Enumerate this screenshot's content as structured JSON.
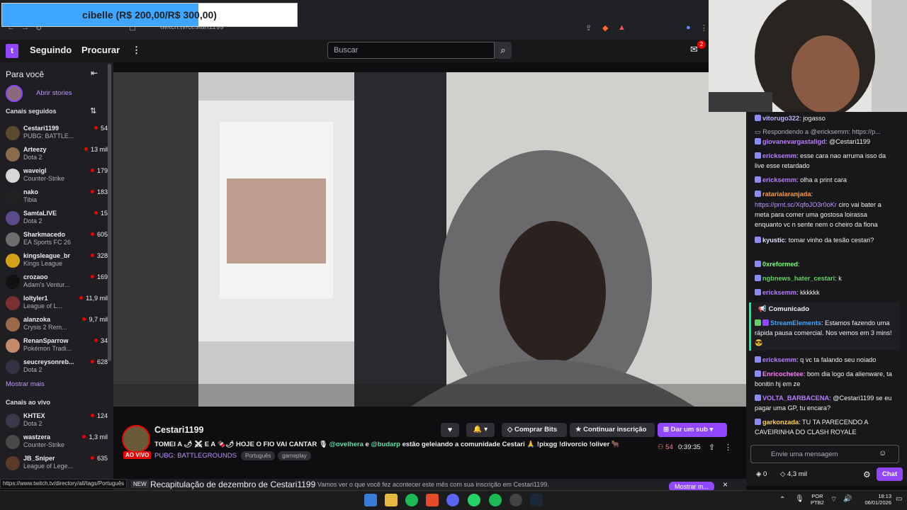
{
  "goal_bar": {
    "text": "cibelle (R$ 200,00/R$ 300,00)",
    "progress": 0.667,
    "fill_color": "#3ea6ff"
  },
  "browser": {
    "url": "twitch.tv/cestari1199"
  },
  "nav": {
    "following": "Seguindo",
    "browse": "Procurar",
    "more": "⋮",
    "search_placeholder": "Buscar",
    "inbox_badge": "2"
  },
  "sidebar": {
    "for_you": "Para você",
    "stories": "Abrir stories",
    "followed_title": "Canais seguidos",
    "followed": [
      {
        "name": "Cestari1199",
        "game": "PUBG: BATTLE...",
        "viewers": "54",
        "color": "#5a4a2e"
      },
      {
        "name": "Arteezy",
        "game": "Dota 2",
        "viewers": "13 mil",
        "color": "#8a6b4e"
      },
      {
        "name": "waveigl",
        "game": "Counter-Strike",
        "viewers": "179",
        "color": "#d8d8d8"
      },
      {
        "name": "nako",
        "game": "Tibia",
        "viewers": "183",
        "color": "#222222"
      },
      {
        "name": "SamtaLIVE",
        "game": "Dota 2",
        "viewers": "15",
        "color": "#5b4b8a"
      },
      {
        "name": "Sharkmacedo",
        "game": "EA Sports FC 26",
        "viewers": "605",
        "color": "#6d6d6d"
      },
      {
        "name": "kingsleague_br",
        "game": "Kings League",
        "viewers": "328",
        "color": "#d4a017"
      },
      {
        "name": "crozaoo",
        "game": "Adam's Ventur...",
        "viewers": "169",
        "color": "#111111"
      },
      {
        "name": "loltyler1",
        "game": "League of L...",
        "viewers": "11,9 mil",
        "color": "#7a3030"
      },
      {
        "name": "alanzoka",
        "game": "Crysis 2 Rem...",
        "viewers": "9,7 mil",
        "color": "#9a6a4a"
      },
      {
        "name": "RenanSparrow",
        "game": "Pokémon Tradi...",
        "viewers": "34",
        "color": "#c48a6a"
      },
      {
        "name": "seucreysonreb...",
        "game": "Dota 2",
        "viewers": "628",
        "color": "#333344"
      }
    ],
    "show_more": "Mostrar mais",
    "live_title": "Canais ao vivo",
    "live": [
      {
        "name": "KHTEX",
        "game": "Dota 2",
        "viewers": "124",
        "color": "#3a3a4a"
      },
      {
        "name": "wastzera",
        "game": "Counter-Strike",
        "viewers": "1,3 mil",
        "color": "#4a4a4a"
      },
      {
        "name": "JB_Sniper",
        "game": "League of Lege...",
        "viewers": "635",
        "color": "#5a3a2a"
      }
    ]
  },
  "stream": {
    "channel": "Cestari1199",
    "live_badge": "AO VIVO",
    "title_a": "TOMEI A 🌶 ⚔ E A 🍫🌶 HOJE O FIO VAI CANTAR 🎙",
    "mention1": "@ovelhera",
    "title_and": " e ",
    "mention2": "@budarp",
    "title_b": " estão geleiando a comunidade Cestari 🙏 !pixgg !divorcio !oliver 🐂",
    "category": "PUBG: BATTLEGROUNDS",
    "tags": [
      "Português",
      "gameplay"
    ],
    "viewers": "54",
    "uptime": "0:39:35",
    "buy_bits": "Comprar Bits",
    "continue_sub": "Continuar inscrição",
    "gift_sub": "Dar um sub"
  },
  "recap": {
    "new": "NEW",
    "title": "Recapitulação de dezembro de Cestari1199",
    "text": "Vamos ver o que você fez acontecer este mês com sua inscrição em Cestari1199.",
    "button": "Mostrar m..."
  },
  "status_url": "https://www.twitch.tv/directory/all/tags/Português",
  "chat": {
    "messages": [
      {
        "user": "vitorugo322",
        "color": "#b8b8ff",
        "text": "jogasso"
      },
      {
        "reply": "Respondendo a @ericksemm: https://p..."
      },
      {
        "user": "giovanevargastaligd",
        "color": "#b87cff",
        "text": "@Cestari1199"
      },
      {
        "user": "ericksemm",
        "color": "#b87cff",
        "text": "esse cara nao arruma isso da live esse retardado"
      },
      {
        "user": "ericksemm",
        "color": "#b87cff",
        "text": "olha a print cara"
      },
      {
        "user": "ratarialaranjada",
        "color": "#ff9a3c",
        "text": ""
      },
      {
        "link": "https://prnt.sc/XqfoJO3r0oKr",
        "text": " ciro vai bater a meta para comer uma gostosa loirassa enquanto vc n sente nem o cheiro da fiona"
      },
      {
        "user": "kyustic",
        "color": "#e0e0ff",
        "text": "tomar vinho da tesão cestari?"
      },
      {
        "user": "0xreformed",
        "color": "#7aff7a",
        "text": ""
      },
      {
        "user": "ngbnews_hater_cestari",
        "color": "#5fd35f",
        "text": "k"
      },
      {
        "user": "ericksemm",
        "color": "#b87cff",
        "text": "kkkkkk"
      }
    ],
    "announcement_label": "Comunicado",
    "announcement_user": "StreamElements",
    "announcement_text": "Estamos fazendo uma rápida pausa comercial. Nos vemos em 3 mins! 😎",
    "messages2": [
      {
        "user": "ericksemm",
        "color": "#b87cff",
        "text": "q vc ta falando seu noiado"
      },
      {
        "user": "Enricochetee",
        "color": "#ff7aff",
        "text": "bom dia logo da alienware, ta bonitin hj em ze"
      },
      {
        "user": "VOLTA_BARBACENA",
        "color": "#b87cff",
        "text": "@Cestari1199 se eu pagar uma GP, tu encara?"
      },
      {
        "user": "garkonzada",
        "color": "#ffd23f",
        "text": "TU TA PARECENDO A CAVEIRINHA DO CLASH ROYALE"
      }
    ],
    "input_placeholder": "Envie uma mensagem",
    "points": "0",
    "bits": "4,3 mil",
    "chat_button": "Chat"
  },
  "taskbar": {
    "lang1": "POR",
    "lang2": "PTB2",
    "time": "18:13",
    "date": "06/01/2026"
  }
}
